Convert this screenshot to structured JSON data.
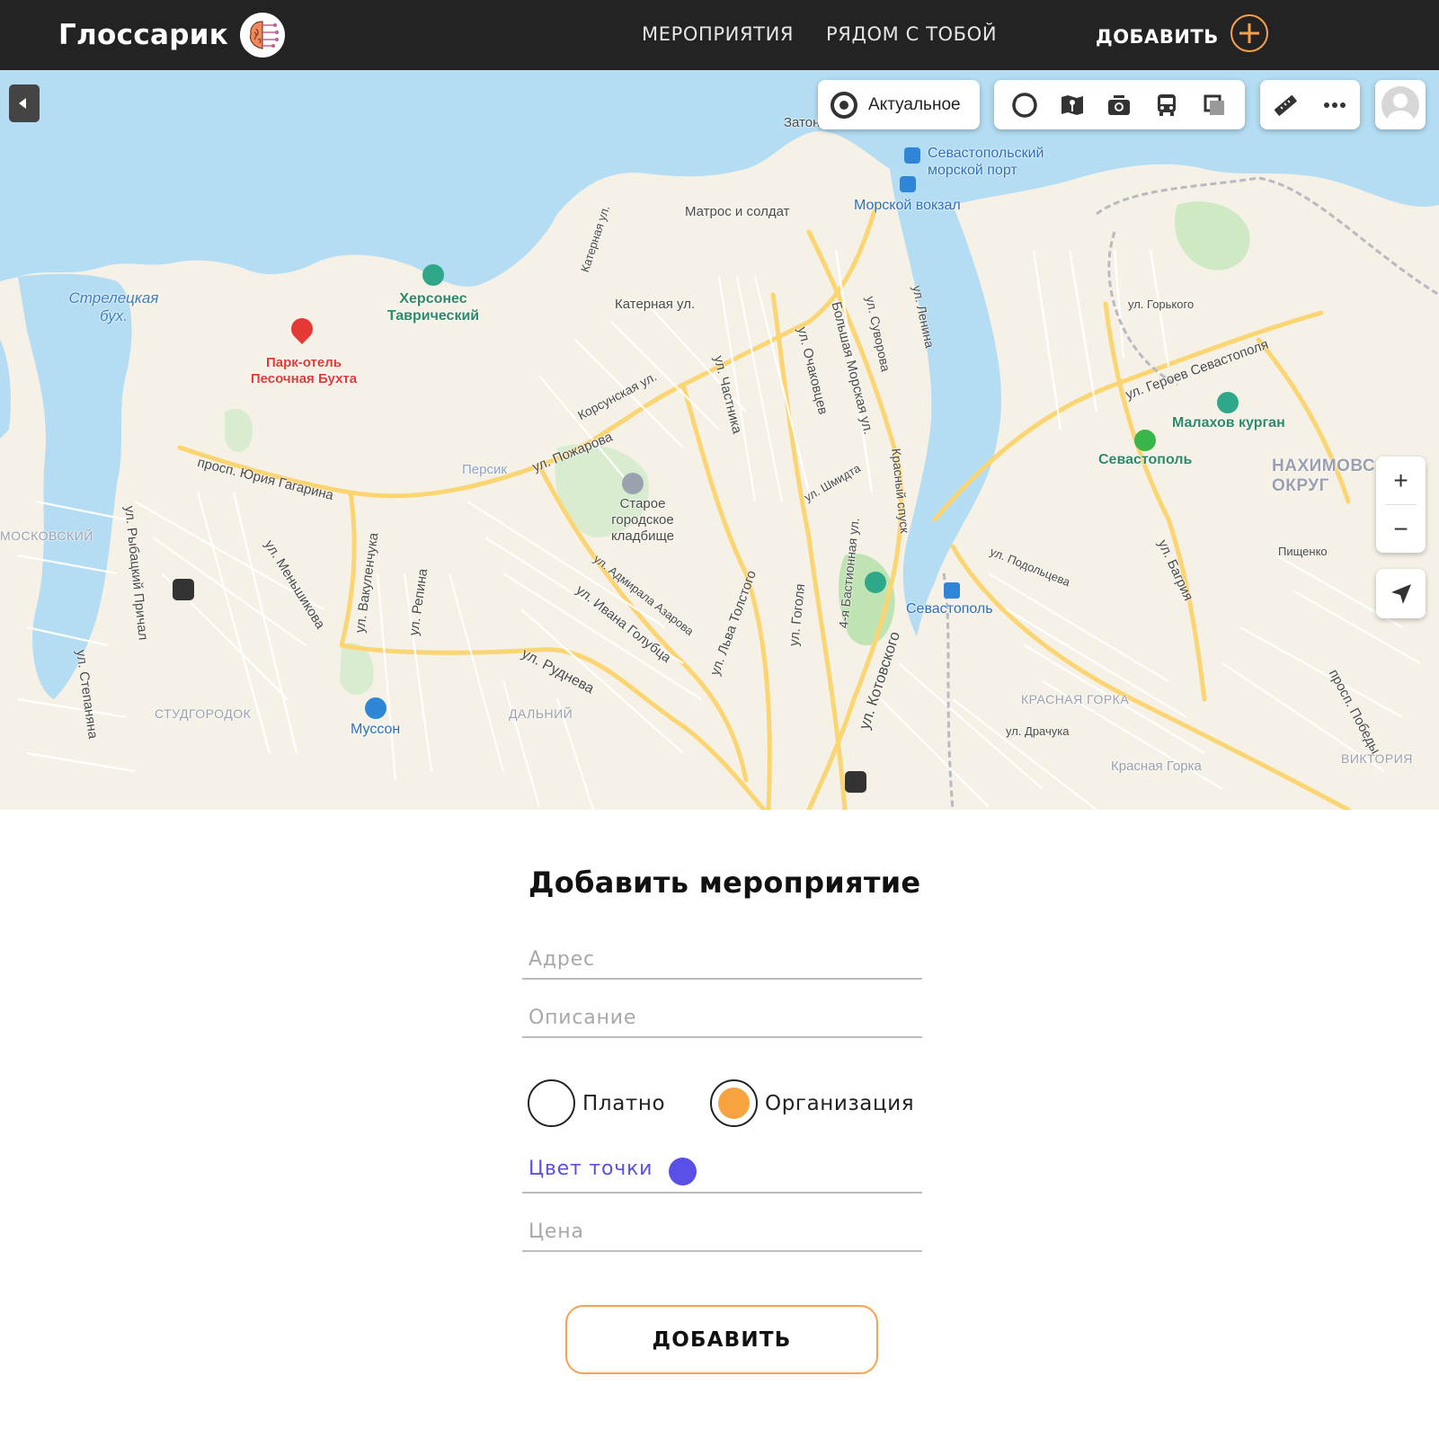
{
  "header": {
    "brand": "Глоссарик",
    "nav": [
      "МЕРОПРИЯТИЯ",
      "РЯДОМ С ТОБОЙ"
    ],
    "add_label": "ДОБАВИТЬ",
    "accent_color": "#f7a24a",
    "background": "#232323"
  },
  "map": {
    "actual_button": "Актуальное",
    "layer_icons": [
      "panorama-icon",
      "traffic-icon",
      "photo-icon",
      "transport-icon",
      "map-layers-icon"
    ],
    "tool_icons": [
      "ruler-icon",
      "more-icon"
    ],
    "zoom_in": "+",
    "zoom_out": "−",
    "labels": {
      "zaton": "Затон кораблям",
      "port": "Севастопольский морской порт",
      "vokzal": "Морской вокзал",
      "matros": "Матрос и солдат",
      "strelets": "Стрелецкая бух.",
      "hersones": "Херсонес Таврический",
      "hotel": "Парк-отель Песочная Бухта",
      "katernaya": "Катерная ул.",
      "katernaya2": "Катерная ул.",
      "korsunskaya": "Корсунская ул.",
      "pozharova": "ул. Пожарова",
      "persik": "Персик",
      "gagarina": "просп. Юрия Гагарина",
      "kladbische": "Старое городское кладбище",
      "shmidta": "ул. Шмидта",
      "gorkogo": "ул. Горького",
      "geroev": "ул. Героев Севастополя",
      "malakhov": "Малахов курган",
      "sevastopol_station": "Севастополь",
      "nakhimov": "НАХИМОВС ОКРУГ",
      "sevastopol2": "Севастополь",
      "moskovsky": "МОСКОВСКИЙ",
      "studgorodok": "СТУДГОРОДОК",
      "musson": "Муссон",
      "rudneva": "ул. Руднева",
      "dalny": "ДАЛЬНИЙ",
      "krasnaya_gorka": "КРАСНАЯ ГОРКА",
      "krasnaya_gorka2": "Красная Горка",
      "drachuka": "ул. Драчука",
      "viktoria": "ВИКТОРИЯ",
      "pischenko": "Пищенко",
      "podolceva": "ул. Подольцева",
      "bagriya": "ул. Багрия",
      "lenina": "ул. Ленина",
      "suvorova": "ул. Суворова",
      "bolshaya_morskaya": "Большая Морская ул.",
      "ochakovtsev": "ул. Очаковцев",
      "chastnika": "ул. Частника",
      "kotovskogo": "ул. Котовского",
      "lva_tolstogo": "ул. Льва Толстого",
      "ivana_golubca": "ул. Ивана Голубца",
      "admirala": "ул. Адмирала Азарова",
      "menshikova": "ул. Меньшикова",
      "vakulenchuka": "ул. Вакуленчука",
      "repina": "ул. Репина",
      "stepanyana": "ул. Степаняна",
      "rybatsky": "ул. Рыбацкий Причал",
      "gogolya": "ул. Гоголя",
      "bastionnaya": "4-я Бастионная ул.",
      "krasny_spusk": "Красный спуск",
      "pobedy": "просп. Победы"
    }
  },
  "form": {
    "title": "Добавить мероприятие",
    "address_placeholder": "Адрес",
    "description_placeholder": "Описание",
    "radio_paid": "Платно",
    "radio_org": "Организация",
    "radio_paid_checked": false,
    "radio_org_checked": true,
    "radio_checked_color": "#f7a440",
    "color_label": "Цвет точки",
    "point_color": "#5a4fe6",
    "price_placeholder": "Цена",
    "submit": "ДОБАВИТЬ"
  }
}
